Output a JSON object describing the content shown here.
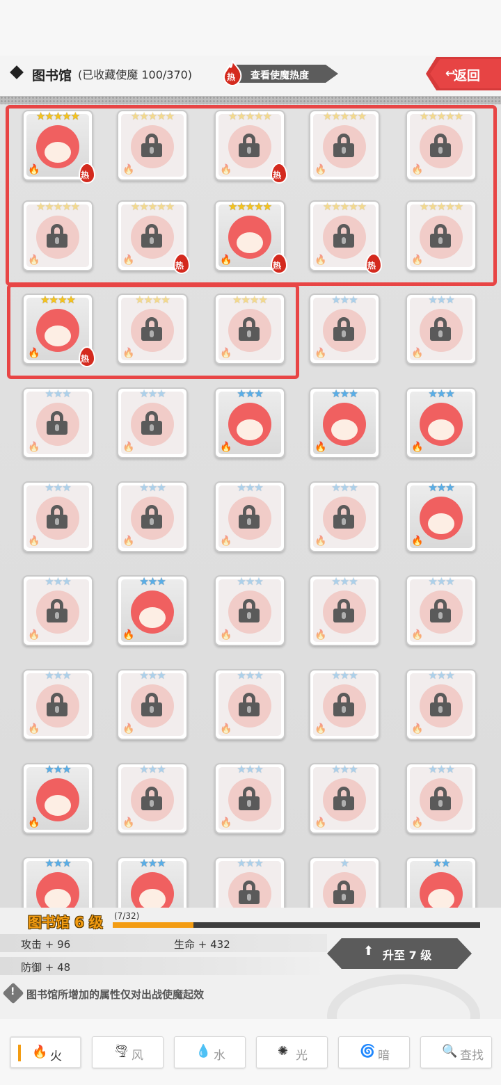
{
  "header": {
    "title": "图书馆",
    "collection": "(已收藏使魔 100/370)",
    "heat_button": "查看使魔热度",
    "heat_badge": "热",
    "back_button": "返回"
  },
  "cards": [
    {
      "stars": 5,
      "locked": false,
      "hot": true
    },
    {
      "stars": 5,
      "locked": true,
      "hot": false
    },
    {
      "stars": 5,
      "locked": true,
      "hot": true
    },
    {
      "stars": 5,
      "locked": true,
      "hot": false
    },
    {
      "stars": 5,
      "locked": true,
      "hot": false
    },
    {
      "stars": 5,
      "locked": true,
      "hot": false
    },
    {
      "stars": 5,
      "locked": true,
      "hot": true
    },
    {
      "stars": 5,
      "locked": false,
      "hot": true
    },
    {
      "stars": 5,
      "locked": true,
      "hot": true
    },
    {
      "stars": 5,
      "locked": true,
      "hot": false
    },
    {
      "stars": 4,
      "locked": false,
      "hot": true
    },
    {
      "stars": 4,
      "locked": true,
      "hot": false
    },
    {
      "stars": 4,
      "locked": true,
      "hot": false
    },
    {
      "stars": 3,
      "locked": true,
      "hot": false
    },
    {
      "stars": 3,
      "locked": true,
      "hot": false
    },
    {
      "stars": 3,
      "locked": true,
      "hot": false
    },
    {
      "stars": 3,
      "locked": true,
      "hot": false
    },
    {
      "stars": 3,
      "locked": false,
      "hot": false
    },
    {
      "stars": 3,
      "locked": false,
      "hot": false
    },
    {
      "stars": 3,
      "locked": false,
      "hot": false
    },
    {
      "stars": 3,
      "locked": true,
      "hot": false
    },
    {
      "stars": 3,
      "locked": true,
      "hot": false
    },
    {
      "stars": 3,
      "locked": true,
      "hot": false
    },
    {
      "stars": 3,
      "locked": true,
      "hot": false
    },
    {
      "stars": 3,
      "locked": false,
      "hot": false
    },
    {
      "stars": 3,
      "locked": true,
      "hot": false
    },
    {
      "stars": 3,
      "locked": false,
      "hot": false
    },
    {
      "stars": 3,
      "locked": true,
      "hot": false
    },
    {
      "stars": 3,
      "locked": true,
      "hot": false
    },
    {
      "stars": 3,
      "locked": true,
      "hot": false
    },
    {
      "stars": 3,
      "locked": true,
      "hot": false
    },
    {
      "stars": 3,
      "locked": true,
      "hot": false
    },
    {
      "stars": 3,
      "locked": true,
      "hot": false
    },
    {
      "stars": 3,
      "locked": true,
      "hot": false
    },
    {
      "stars": 3,
      "locked": true,
      "hot": false
    },
    {
      "stars": 3,
      "locked": false,
      "hot": false
    },
    {
      "stars": 3,
      "locked": true,
      "hot": false
    },
    {
      "stars": 3,
      "locked": true,
      "hot": false
    },
    {
      "stars": 3,
      "locked": true,
      "hot": false
    },
    {
      "stars": 3,
      "locked": true,
      "hot": false
    },
    {
      "stars": 3,
      "locked": false,
      "hot": false
    },
    {
      "stars": 3,
      "locked": false,
      "hot": false
    },
    {
      "stars": 3,
      "locked": true,
      "hot": false
    },
    {
      "stars": 1,
      "locked": true,
      "hot": false
    },
    {
      "stars": 2,
      "locked": false,
      "hot": false
    }
  ],
  "colors": {
    "accent_red": "#e84545",
    "gold_star": "#f5c31c",
    "blue_star": "#58aee8",
    "level_orange": "#f39c12"
  },
  "level": {
    "title": "图书馆 6 级",
    "progress_text": "(7/32)",
    "progress": 0.22,
    "attack": "攻击 + 96",
    "hp": "生命 + 432",
    "defense": "防御 + 48",
    "upgrade_button": "升至 7 级",
    "notice": "图书馆所增加的属性仅对出战使魔起效"
  },
  "tabs": [
    {
      "label": "火",
      "icon": "fire-icon",
      "glyph": "🔥",
      "active": true
    },
    {
      "label": "风",
      "icon": "wind-icon",
      "glyph": "🌪",
      "active": false
    },
    {
      "label": "水",
      "icon": "water-icon",
      "glyph": "💧",
      "active": false
    },
    {
      "label": "光",
      "icon": "light-icon",
      "glyph": "✺",
      "active": false
    },
    {
      "label": "暗",
      "icon": "dark-icon",
      "glyph": "🌀",
      "active": false
    },
    {
      "label": "查找",
      "icon": "search-icon",
      "glyph": "🔍",
      "active": false
    }
  ]
}
